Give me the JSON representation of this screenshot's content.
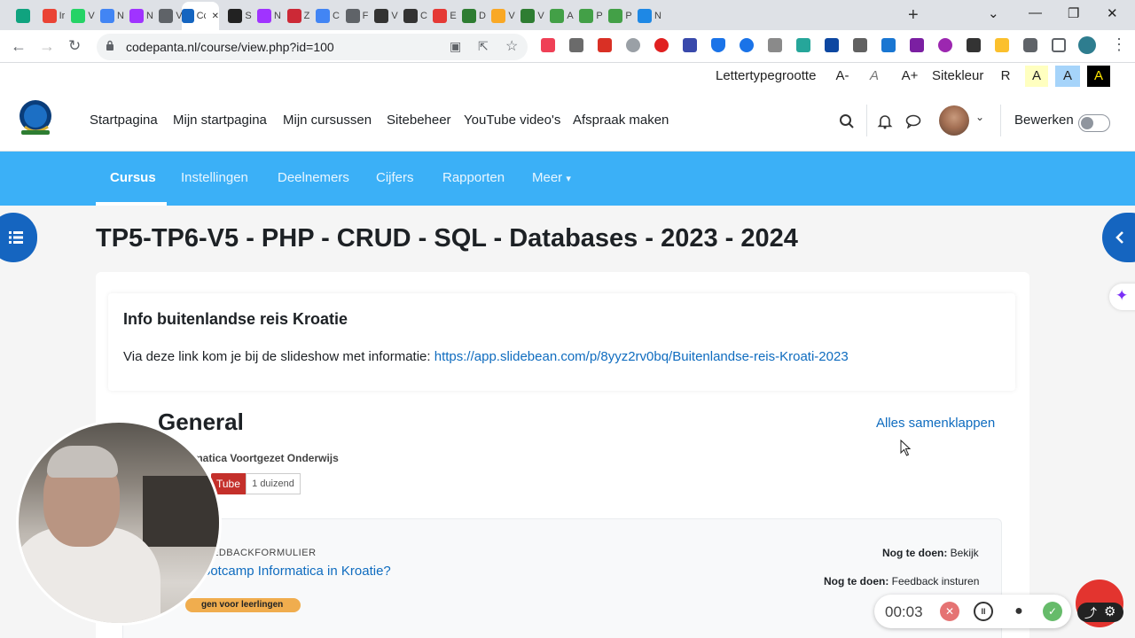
{
  "browser": {
    "tabs": [
      {
        "label": "",
        "icon": "chatgpt-icon",
        "color": "#10a37f"
      },
      {
        "label": "Ir",
        "icon": "gmail-icon",
        "color": "#ea4335"
      },
      {
        "label": "V",
        "icon": "whatsapp-icon",
        "color": "#25d366"
      },
      {
        "label": "N",
        "icon": "docs-icon",
        "color": "#4285f4"
      },
      {
        "label": "N",
        "icon": "messenger-icon",
        "color": "#a033ff"
      },
      {
        "label": "V",
        "icon": "globe-icon",
        "color": "#5f6368"
      },
      {
        "label": "Cc",
        "icon": "page-icon",
        "color": "#1565c0"
      },
      {
        "label": "S",
        "icon": "quora-icon",
        "color": "#222222"
      },
      {
        "label": "N",
        "icon": "messenger-icon",
        "color": "#a033ff"
      },
      {
        "label": "Z",
        "icon": "zotero-icon",
        "color": "#cc2936"
      },
      {
        "label": "C",
        "icon": "calendar-icon",
        "color": "#4285f4"
      },
      {
        "label": "F",
        "icon": "globe-icon",
        "color": "#5f6368"
      },
      {
        "label": "V",
        "icon": "panda-icon",
        "color": "#333333"
      },
      {
        "label": "C",
        "icon": "panda-icon",
        "color": "#333333"
      },
      {
        "label": "E",
        "icon": "chart-icon",
        "color": "#e53935"
      },
      {
        "label": "D",
        "icon": "bird-icon",
        "color": "#2e7d32"
      },
      {
        "label": "V",
        "icon": "trophy-icon",
        "color": "#f9a825"
      },
      {
        "label": "V",
        "icon": "bird-icon",
        "color": "#2e7d32"
      },
      {
        "label": "A",
        "icon": "infinity-icon",
        "color": "#43a047"
      },
      {
        "label": "P",
        "icon": "infinity-icon",
        "color": "#43a047"
      },
      {
        "label": "P",
        "icon": "infinity-icon",
        "color": "#43a047"
      },
      {
        "label": "N",
        "icon": "m-icon",
        "color": "#1e88e5"
      }
    ],
    "url": "codepanta.nl/course/view.php?id=100"
  },
  "accessibility": {
    "font_size_label": "Lettertypegrootte",
    "decrease": "A-",
    "reset": "A",
    "increase": "A+",
    "color_label": "Sitekleur",
    "color_reset": "R",
    "color_options": [
      "A",
      "A",
      "A"
    ]
  },
  "site_nav": {
    "items": [
      "Startpagina",
      "Mijn startpagina",
      "Mijn cursussen",
      "Sitebeheer",
      "YouTube video's",
      "Afspraak maken"
    ],
    "edit_label": "Bewerken"
  },
  "course_nav": {
    "tabs": [
      "Cursus",
      "Instellingen",
      "Deelnemers",
      "Cijfers",
      "Rapporten",
      "Meer"
    ],
    "active_tab": "Cursus"
  },
  "page": {
    "title": "TP5-TP6-V5 - PHP - CRUD - SQL - Databases - 2023 - 2024",
    "info_title": "Info buitenlandse reis Kroatie",
    "info_text": "Via deze link kom je bij de slideshow met informatie: ",
    "info_link": "https://app.slidebean.com/p/8yyz2rv0bq/Buitenlandse-reis-Kroati-2023",
    "section_title": "General",
    "collapse_all": "Alles samenklappen",
    "channel_name": "matica Voortgezet Onderwijs",
    "youtube_label": "Tube",
    "subscriber_count": "1 duizend",
    "activity_type": "EDBACKFORMULIER",
    "activity_name": "ootcamp Informatica in Kroatie?",
    "todo_label": "Nog te doen:",
    "todo_1": "Bekijk",
    "todo_2": "Feedback insturen",
    "badge_text": "gen voor leerlingen"
  },
  "recorder": {
    "time": "00:03"
  }
}
